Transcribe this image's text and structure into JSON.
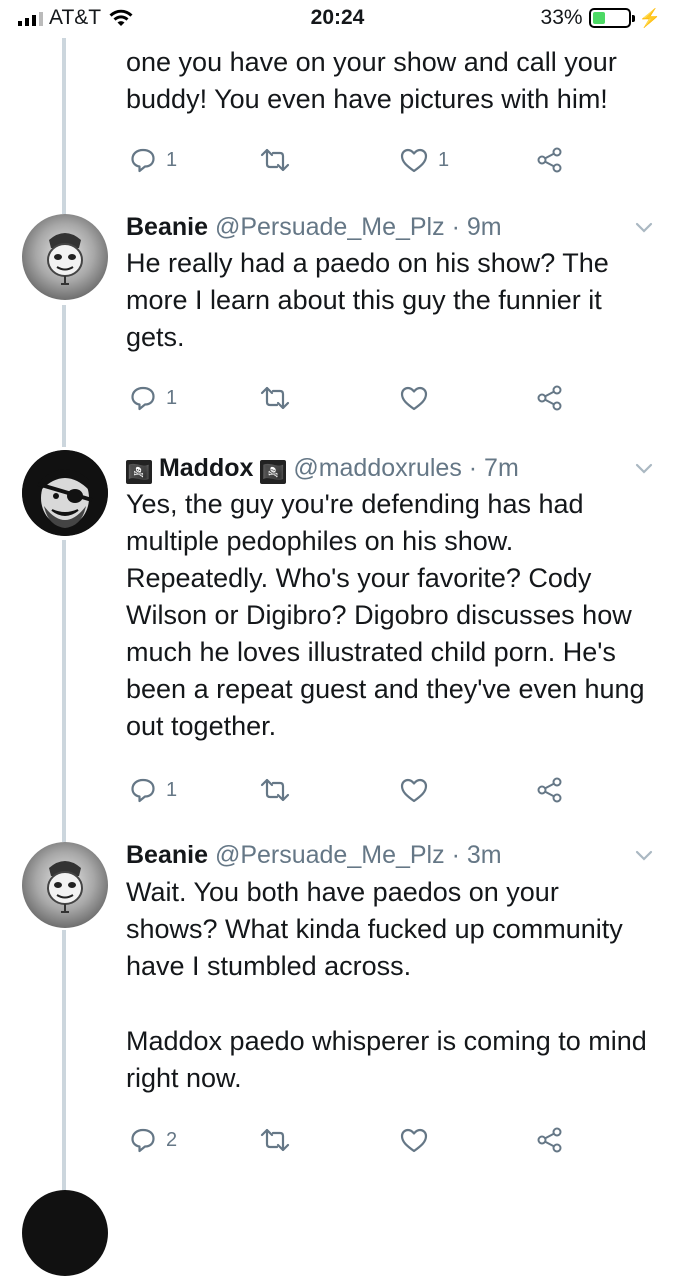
{
  "status_bar": {
    "carrier": "AT&T",
    "time": "20:24",
    "battery_percent": "33%",
    "battery_level": 0.33
  },
  "tweets": [
    {
      "text": "one you have on your show and call your buddy! You even have pictures with him!",
      "reply_count": "1",
      "like_count": "1"
    },
    {
      "name": "Beanie",
      "handle": "@Persuade_Me_Plz",
      "time": "· 9m",
      "text": "He really had a paedo on his show? The more I learn about this guy the funnier it gets.",
      "reply_count": "1"
    },
    {
      "name_prefix_icon": "🏴‍☠️",
      "name": "Maddox",
      "name_suffix_icon": "🏴‍☠️",
      "handle": "@maddoxrules",
      "time": "· 7m",
      "text": "Yes, the guy you're defending has had multiple pedophiles on his show. Repeatedly. Who's your favorite? Cody Wilson or Digibro? Digobro discusses how much he loves illustrated child porn. He's been a repeat guest and they've even hung out together.",
      "reply_count": "1"
    },
    {
      "name": "Beanie",
      "handle": "@Persuade_Me_Plz",
      "time": "· 3m",
      "text_p1": "Wait. You both have paedos on your shows? What kinda fucked up community have I stumbled across.",
      "text_p2": "Maddox paedo whisperer is coming to mind right now.",
      "reply_count": "2"
    }
  ],
  "icons": {
    "reply": "reply-icon",
    "retweet": "retweet-icon",
    "like": "heart-icon",
    "share": "share-icon",
    "more": "chevron-down-icon"
  },
  "colors": {
    "text": "#14171a",
    "secondary": "#657786",
    "thread_line": "#ccd6dd",
    "battery": "#4cd964"
  }
}
